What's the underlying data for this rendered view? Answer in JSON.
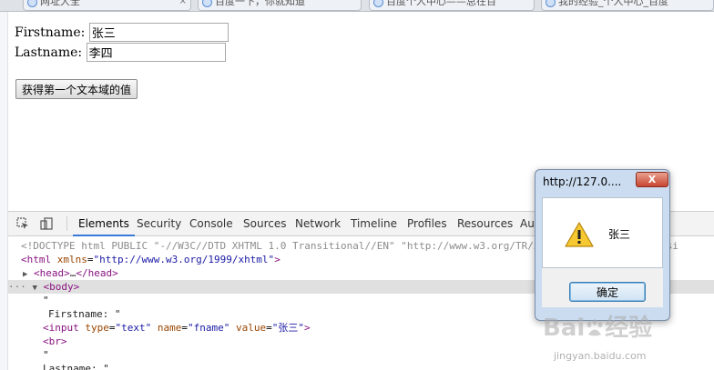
{
  "browser": {
    "tabs": [
      {
        "label": "网址大全"
      },
      {
        "label": "百度一下，你就知道"
      },
      {
        "label": "百度个人中心——总在百"
      },
      {
        "label": "我的经验_个人中心_百度"
      }
    ],
    "tab_close_glyph": "×"
  },
  "form": {
    "firstname_label": "Firstname:",
    "firstname_value": "张三",
    "lastname_label": "Lastname:",
    "lastname_value": "李四",
    "button_label": "获得第一个文本域的值"
  },
  "devtools": {
    "tabs": [
      "Elements",
      "Security",
      "Console",
      "Sources",
      "Network",
      "Timeline",
      "Profiles",
      "Resources",
      "Au"
    ],
    "active_tab": "Elements",
    "code": {
      "doctype": "<!DOCTYPE html PUBLIC \"-//W3C//DTD XHTML 1.0 Transitional//EN\" \"http://www.w3.org/TR/xhtml1/DTD/xhtml1-transi",
      "html_open_tag": "<html",
      "html_xmlns_attr": "xmlns",
      "html_xmlns_value": "\"http://www.w3.org/1999/xhtml\"",
      "html_close": ">",
      "head_tag": "<head>",
      "head_ellipsis": "…",
      "head_close": "</head>",
      "body_tag": "<body>",
      "body_dots": "···",
      "quote": "\"",
      "firstname_text": "Firstname: \"",
      "input_open": "<input",
      "type_attr": "type",
      "type_value": "\"text\"",
      "name_attr": "name",
      "name_value": "\"fname\"",
      "value_attr": "value",
      "value_value": "\"张三\"",
      "input_close": ">",
      "br_tag": "<br>",
      "lastname_text": "Lastname: \""
    }
  },
  "alert": {
    "title": "http://127.0....",
    "close_label": "X",
    "message": "张三",
    "ok_label": "确定"
  },
  "watermark": {
    "brand_left": "Bai",
    "brand_right": "经验",
    "url": "jingyan.baidu.com"
  }
}
